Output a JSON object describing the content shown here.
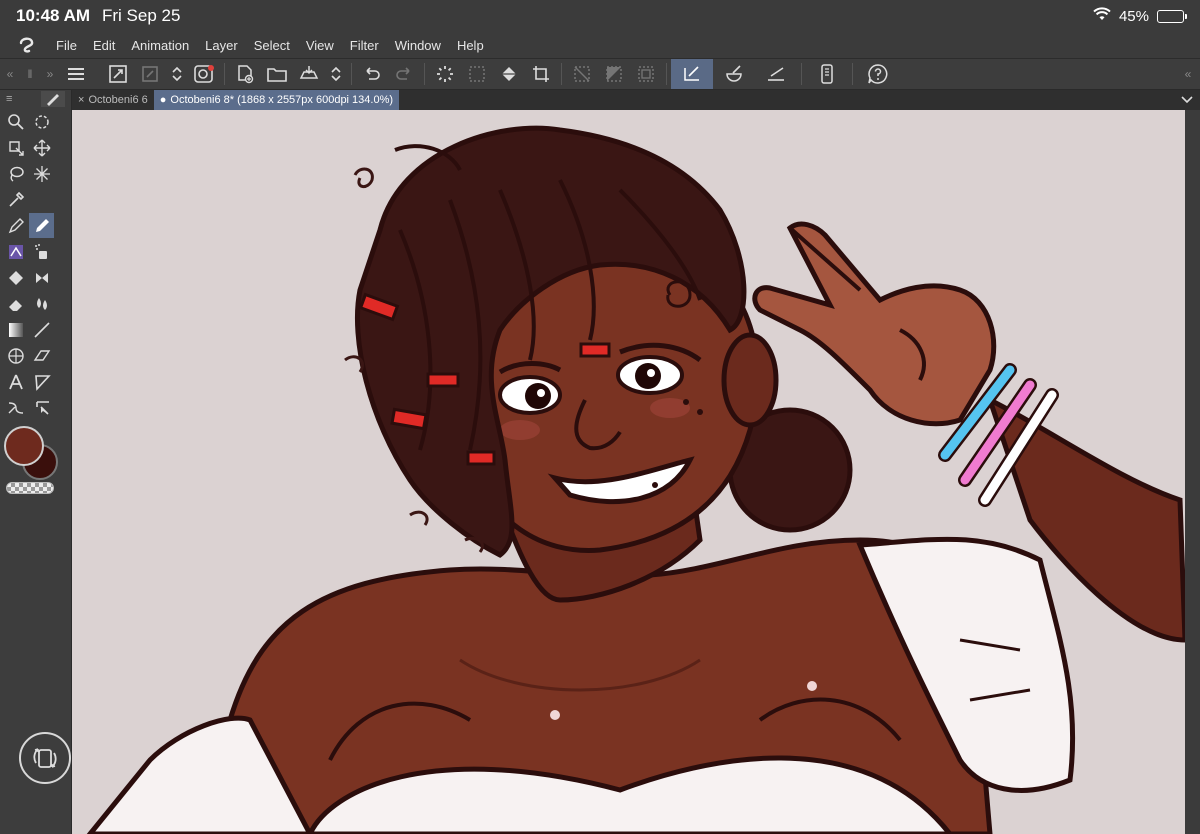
{
  "status": {
    "time": "10:48 AM",
    "date": "Fri Sep 25",
    "battery": "45%",
    "battery_level": 0.45
  },
  "menu": [
    "File",
    "Edit",
    "Animation",
    "Layer",
    "Select",
    "View",
    "Filter",
    "Window",
    "Help"
  ],
  "tabs": [
    {
      "label": "Octobeni6 6",
      "marker": "×",
      "active": false
    },
    {
      "label": "Octobeni6 8* (1868 x 2557px 600dpi 134.0%)",
      "marker": "●",
      "active": true
    }
  ],
  "colors": {
    "main": "#6e2a1e",
    "sub": "#3a0f0c",
    "accent": "#5b6d8c",
    "canvas_bg": "#dbd2d2"
  },
  "toolbar_icons": [
    "menu-icon",
    "resize-icon",
    "transform-icon",
    "stepper-icon",
    "color-icon",
    "new-icon",
    "open-icon",
    "save-icon",
    "undo-icon",
    "redo-icon",
    "loading-icon",
    "selection-icon",
    "fill-icon",
    "crop-icon",
    "edit-icon",
    "ruler-icon",
    "help-icon"
  ]
}
